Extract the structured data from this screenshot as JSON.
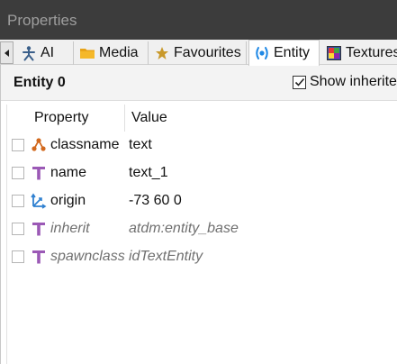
{
  "window": {
    "title": "Properties"
  },
  "tabs": [
    {
      "label": "AI",
      "icon": "ai-figure-icon"
    },
    {
      "label": "Media",
      "icon": "folder-icon"
    },
    {
      "label": "Favourites",
      "icon": "star-icon"
    },
    {
      "label": "Entity",
      "icon": "entity-icon",
      "active": true
    },
    {
      "label": "Textures",
      "icon": "textures-icon"
    }
  ],
  "entity": {
    "title": "Entity 0",
    "show_inherited_label": "Show inherited",
    "show_inherited_checked": true
  },
  "table": {
    "columns": [
      "Property",
      "Value"
    ],
    "rows": [
      {
        "property": "classname",
        "value": "text",
        "icon": "classname-icon",
        "inherited": false
      },
      {
        "property": "name",
        "value": "text_1",
        "icon": "text-type-icon",
        "inherited": false
      },
      {
        "property": "origin",
        "value": "-73 60 0",
        "icon": "vector-axes-icon",
        "inherited": false
      },
      {
        "property": "inherit",
        "value": "atdm:entity_base",
        "icon": "text-type-icon",
        "inherited": true
      },
      {
        "property": "spawnclass",
        "value": "idTextEntity",
        "icon": "text-type-icon",
        "inherited": true
      }
    ]
  },
  "colors": {
    "title_bg": "#3c3c3c",
    "text_icon": "#9b59b6",
    "classname_icon": "#d2691e",
    "vector_icon": "#2f80d0",
    "entity_tab_icon": "#1e88e5"
  }
}
